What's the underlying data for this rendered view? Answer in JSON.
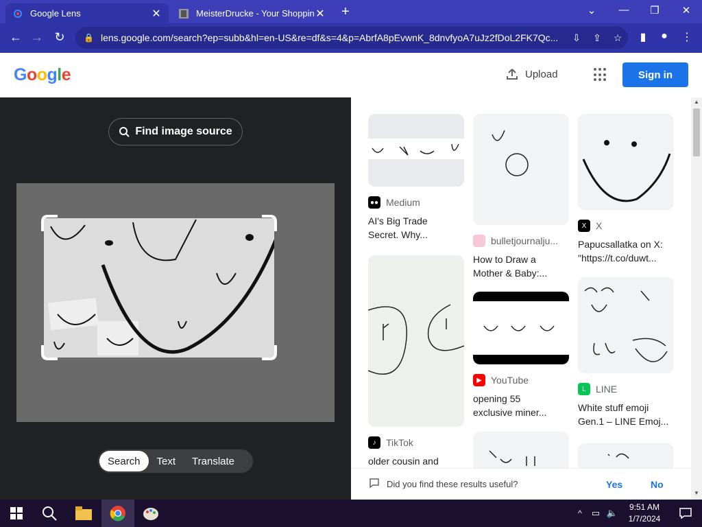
{
  "browser": {
    "tabs": [
      {
        "title": "Google Lens",
        "icon": "google-lens-icon"
      },
      {
        "title": "MeisterDrucke - Your Shopping",
        "icon": "meisterdrucke-icon"
      }
    ],
    "url": "lens.google.com/search?ep=subb&hl=en-US&re=df&s=4&p=AbrfA8pEvwnK_8dnvfyoA7uJz2fDoL2FK7Qc..."
  },
  "header": {
    "logo": "Google",
    "upload_label": "Upload",
    "signin_label": "Sign in"
  },
  "left": {
    "find_source_label": "Find image source",
    "modes": [
      "Search",
      "Text",
      "Translate"
    ]
  },
  "results": [
    {
      "source": "Medium",
      "caption1": "AI's Big Trade",
      "caption2": "Secret. Why..."
    },
    {
      "source": "bulletjournalju...",
      "caption1": "How to Draw a",
      "caption2": "Mother & Baby:..."
    },
    {
      "source": "X",
      "caption1": "Papucsallatka on X:",
      "caption2": "\"https://t.co/duwt..."
    },
    {
      "source": "TikTok",
      "caption1": "older cousin and",
      "caption2": ""
    },
    {
      "source": "YouTube",
      "caption1": "opening 55",
      "caption2": "exclusive miner..."
    },
    {
      "source": "LINE",
      "caption1": "White stuff emoji",
      "caption2": "Gen.1 – LINE Emoj..."
    }
  ],
  "feedback": {
    "question": "Did you find these results useful?",
    "yes": "Yes",
    "no": "No"
  },
  "taskbar": {
    "time": "9:51 AM",
    "date": "1/7/2024"
  },
  "colors": {
    "tabbar": "#3c3fb8",
    "accent": "#1a73e8",
    "lens_bg": "#202124"
  }
}
